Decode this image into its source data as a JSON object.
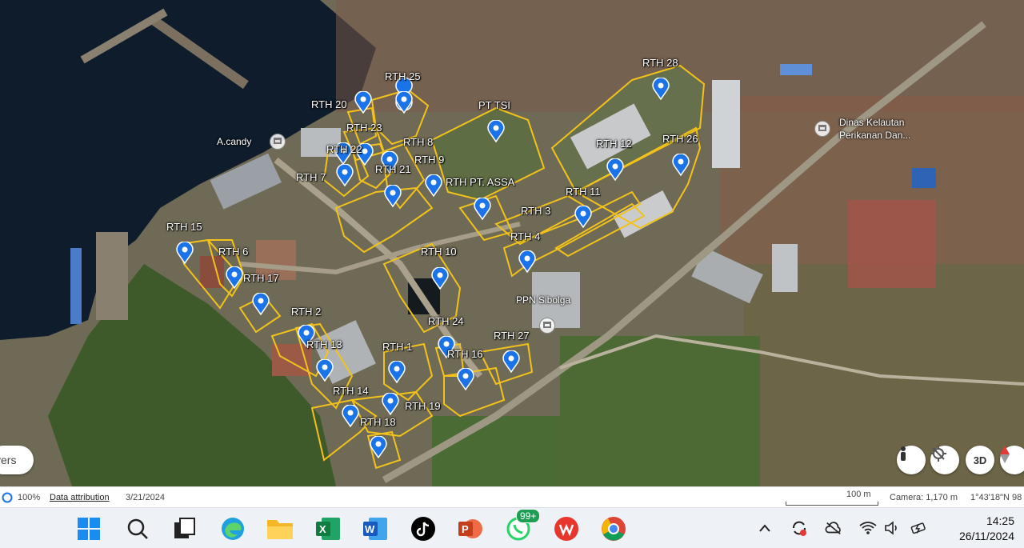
{
  "map": {
    "labels": {
      "rth25": "RTH 25",
      "rth20": "RTH 20",
      "rth23": "RTH 23",
      "rth8": "RTH 8",
      "rth22": "RTH 22",
      "rth9": "RTH 9",
      "rth7": "RTH 7",
      "rth21": "RTH 21",
      "ptTsi": "PT TSI",
      "rthPtAssa": "RTH PT. ASSA",
      "rth28": "RTH 28",
      "rth12": "RTH 12",
      "rth26": "RTH 26",
      "rth11": "RTH 11",
      "rth3": "RTH 3",
      "rth4": "RTH 4",
      "rth15": "RTH 15",
      "rth6": "RTH 6",
      "rth17": "RTH 17",
      "rth10": "RTH 10",
      "rth2": "RTH 2",
      "rth24": "RTH 24",
      "rth13": "RTH 13",
      "rth1": "RTH 1",
      "rth16": "RTH 16",
      "rth27": "RTH 27",
      "rth14": "RTH 14",
      "rth19": "RTH 19",
      "rth18": "RTH 18"
    },
    "places": {
      "acandy": "A.candy",
      "dinas1": "Dinas Kelautan",
      "dinas2": "Perikanan Dan...",
      "ppn": "PPN Sibolga"
    },
    "layers_label": "yers",
    "ctrl_3d": "3D"
  },
  "status": {
    "zoom": "100%",
    "attribution": "Data attribution",
    "date": "3/21/2024",
    "scale": "100 m",
    "camera": "Camera: 1,170 m",
    "coords": "1°43'18\"N 98"
  },
  "taskbar": {
    "whatsapp_badge": "99+",
    "time": "14:25",
    "date": "26/11/2024"
  },
  "colors": {
    "outline": "#f2c21b",
    "pin": "#1a73e8",
    "water": "#0e1c2b"
  }
}
